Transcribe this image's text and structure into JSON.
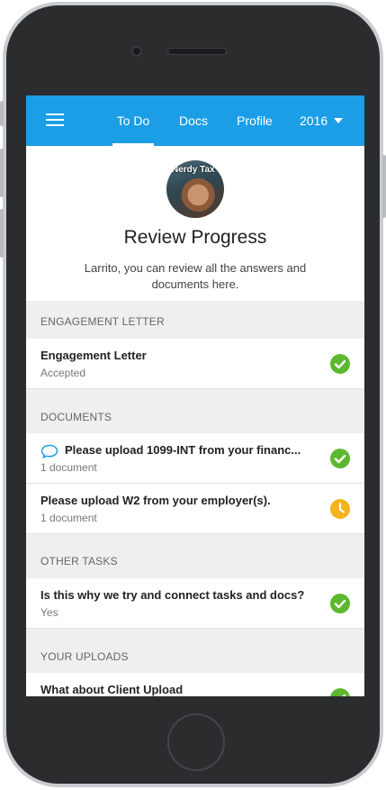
{
  "navbar": {
    "tabs": [
      {
        "label": "To Do",
        "active": true
      },
      {
        "label": "Docs",
        "active": false
      },
      {
        "label": "Profile",
        "active": false
      }
    ],
    "year": "2016",
    "accent_color": "#1c9ee6"
  },
  "header": {
    "avatar_logo_text": "Nerdy Tax™",
    "title": "Review Progress",
    "subtitle": "Larrito, you can review all the answers and documents here."
  },
  "sections": {
    "engagement": {
      "label": "ENGAGEMENT LETTER",
      "items": [
        {
          "title": "Engagement Letter",
          "subtitle": "Accepted",
          "status": "complete"
        }
      ]
    },
    "documents": {
      "label": "DOCUMENTS",
      "items": [
        {
          "title": "Please upload 1099-INT from your financ...",
          "subtitle": "1 document",
          "status": "complete",
          "has_comment": true
        },
        {
          "title": "Please upload W2 from your employer(s).",
          "subtitle": "1 document",
          "status": "pending"
        }
      ]
    },
    "other_tasks": {
      "label": "OTHER TASKS",
      "items": [
        {
          "title": "Is this why we try and connect tasks and docs?",
          "subtitle": "Yes",
          "status": "complete"
        }
      ]
    },
    "uploads": {
      "label": "YOUR UPLOADS",
      "items": [
        {
          "title": "What about Client Upload",
          "subtitle": "",
          "status": "complete"
        }
      ]
    }
  },
  "colors": {
    "complete": "#5cb82e",
    "pending": "#f5b21b",
    "comment": "#1c9ee6"
  }
}
